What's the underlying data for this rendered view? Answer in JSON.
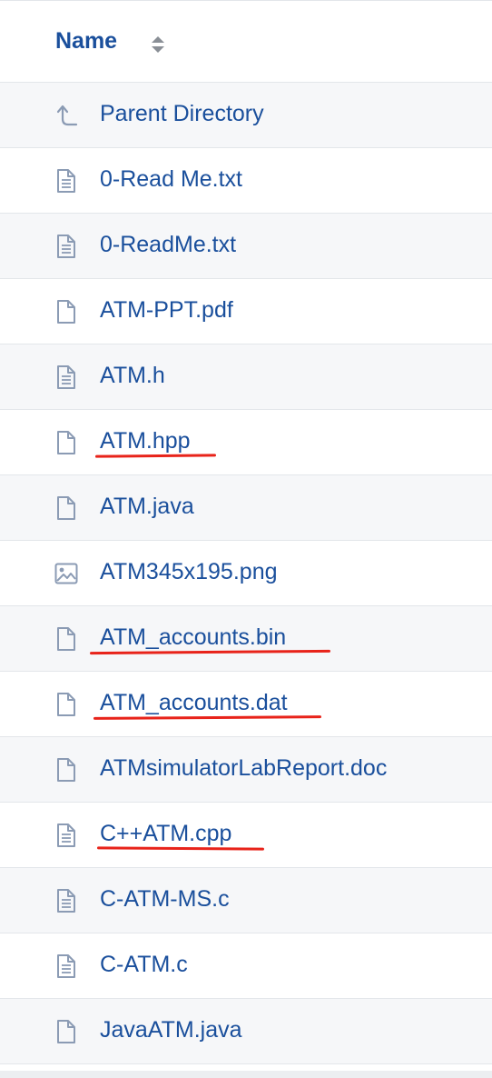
{
  "header": {
    "name_label": "Name"
  },
  "files": [
    {
      "label": "Parent Directory",
      "icon": "parent-directory-icon",
      "underlined": false
    },
    {
      "label": "0-Read Me.txt",
      "icon": "text-file-icon",
      "underlined": false
    },
    {
      "label": "0-ReadMe.txt",
      "icon": "text-file-icon",
      "underlined": false
    },
    {
      "label": "ATM-PPT.pdf",
      "icon": "file-icon",
      "underlined": false
    },
    {
      "label": "ATM.h",
      "icon": "text-file-icon",
      "underlined": false
    },
    {
      "label": "ATM.hpp",
      "icon": "file-icon",
      "underlined": true
    },
    {
      "label": "ATM.java",
      "icon": "file-icon",
      "underlined": false
    },
    {
      "label": "ATM345x195.png",
      "icon": "image-file-icon",
      "underlined": false
    },
    {
      "label": "ATM_accounts.bin",
      "icon": "file-icon",
      "underlined": true
    },
    {
      "label": "ATM_accounts.dat",
      "icon": "file-icon",
      "underlined": true
    },
    {
      "label": "ATMsimulatorLabReport.doc",
      "icon": "file-icon",
      "underlined": false
    },
    {
      "label": "C++ATM.cpp",
      "icon": "text-file-icon",
      "underlined": true
    },
    {
      "label": "C-ATM-MS.c",
      "icon": "text-file-icon",
      "underlined": false
    },
    {
      "label": "C-ATM.c",
      "icon": "text-file-icon",
      "underlined": false
    },
    {
      "label": "JavaATM.java",
      "icon": "file-icon",
      "underlined": false
    }
  ],
  "colors": {
    "link": "#1a4f9c",
    "icon": "#8b9bb4",
    "annotation_underline": "#e8231a"
  }
}
